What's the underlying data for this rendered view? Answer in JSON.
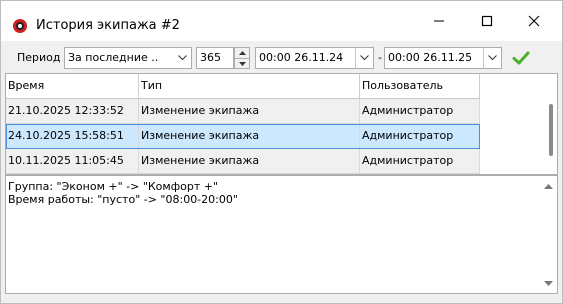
{
  "window": {
    "title": "История экипажа #2",
    "icon": "app-record-icon"
  },
  "toolbar": {
    "period_label": "Период",
    "period_value": "За последние ..",
    "days_value": "365",
    "date_from": "00:00 26.11.24",
    "separator": "-",
    "date_to": "00:00 26.11.25",
    "apply_icon": "checkmark-icon",
    "apply_color": "#4caf2a"
  },
  "grid": {
    "columns": [
      "Время",
      "Тип",
      "Пользователь"
    ],
    "rows": [
      {
        "time": "21.10.2025 12:33:52",
        "type": "Изменение экипажа",
        "user": "Администратор"
      },
      {
        "time": "24.10.2025 15:58:51",
        "type": "Изменение экипажа",
        "user": "Администратор"
      },
      {
        "time": "10.11.2025 11:05:45",
        "type": "Изменение экипажа",
        "user": "Администратор"
      }
    ],
    "selected_row": 1,
    "selection_color": "#cce8ff"
  },
  "details": {
    "lines": [
      "Группа: \"Эконом +\" -> \"Комфорт +\"",
      "Время работы: \"пусто\" -> \"08:00-20:00\""
    ]
  }
}
